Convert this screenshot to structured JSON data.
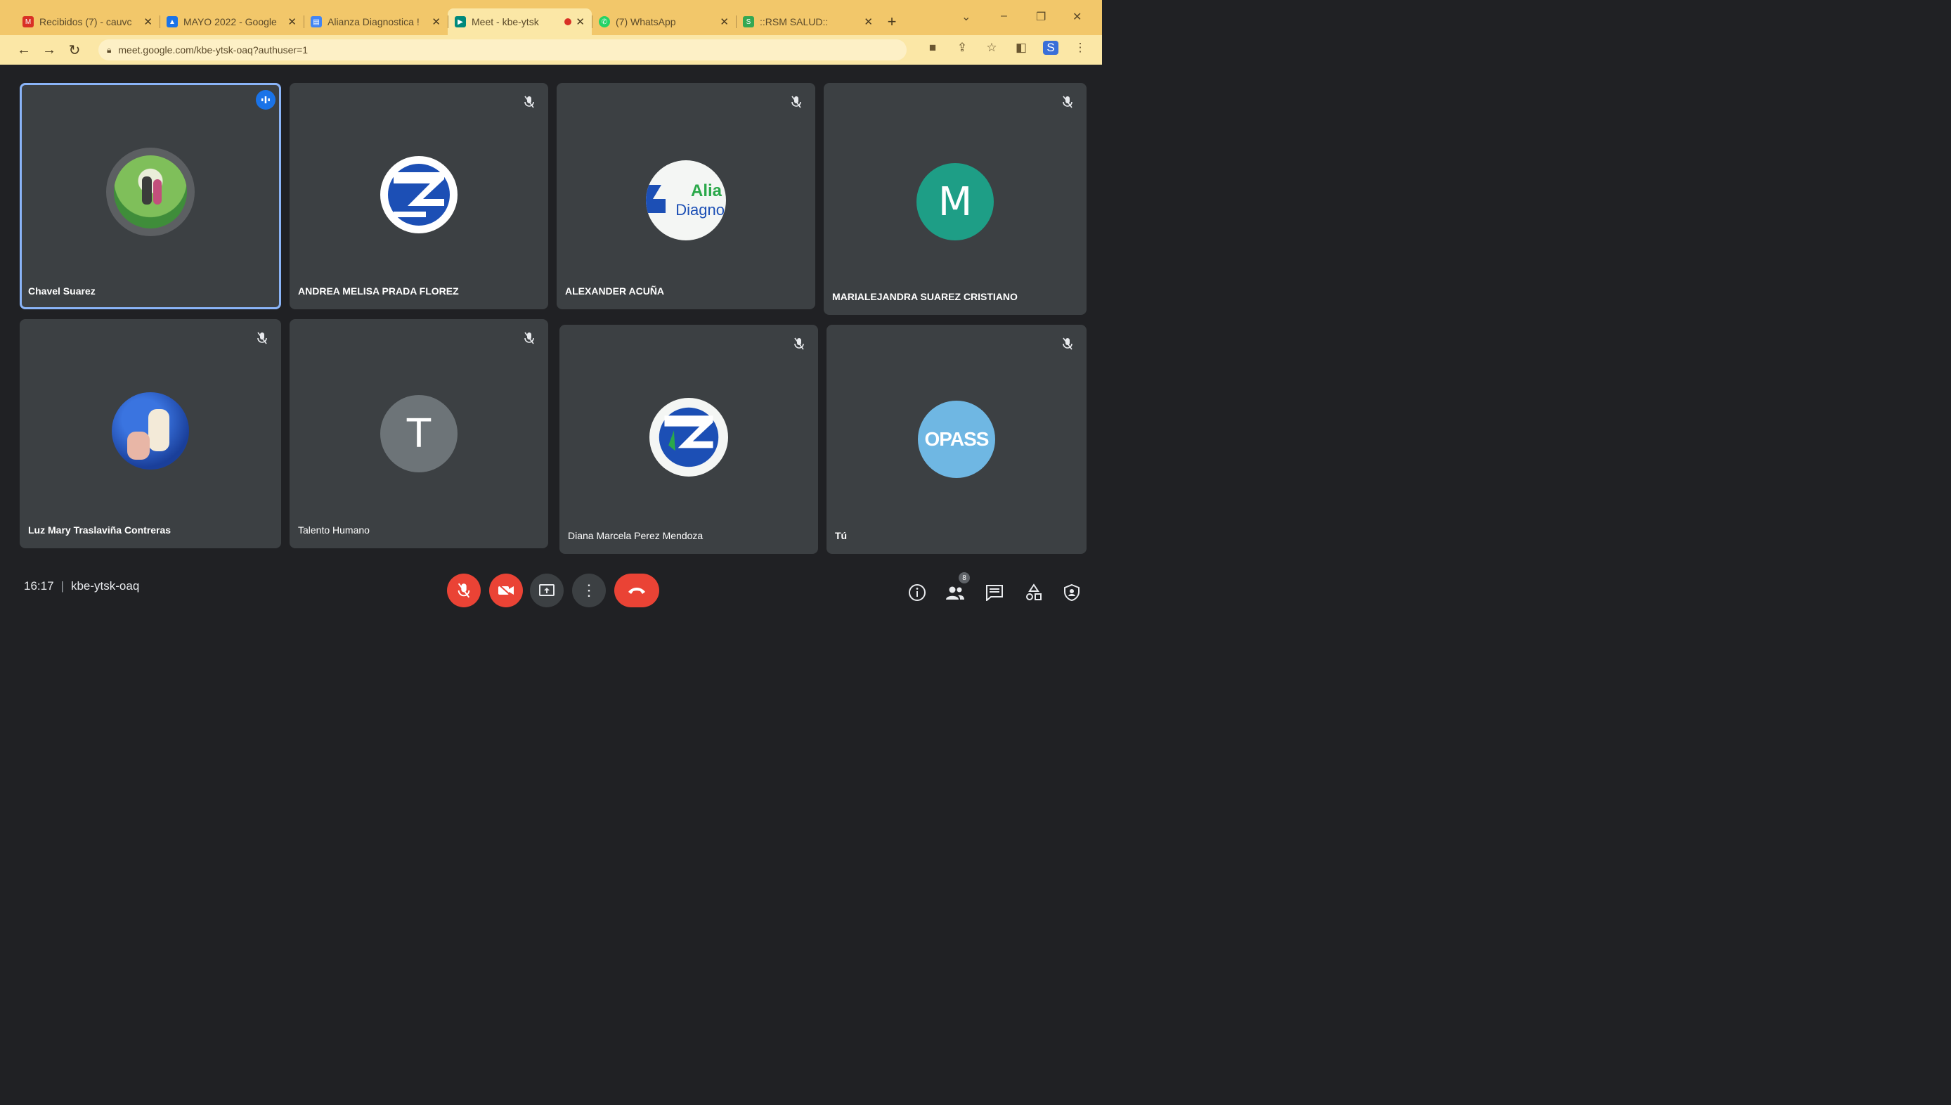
{
  "browser": {
    "tabs": [
      {
        "title": "Recibidos (7) - cauvc",
        "favicon_color": "#d93025",
        "active": false
      },
      {
        "title": "MAYO 2022 - Google",
        "favicon_color": "#1a73e8",
        "active": false
      },
      {
        "title": "Alianza Diagnostica !",
        "favicon_color": "#4285f4",
        "active": false
      },
      {
        "title": "Meet - kbe-ytsk",
        "favicon_color": "#00897b",
        "active": true
      },
      {
        "title": "(7) WhatsApp",
        "favicon_color": "#25d366",
        "active": false
      },
      {
        "title": "::RSM SALUD::",
        "favicon_color": "#34a853",
        "active": false
      }
    ],
    "new_tab_label": "+",
    "url": "meet.google.com/kbe-ytsk-oaq?authuser=1"
  },
  "participants": [
    {
      "name": "Chavel Suarez",
      "avatar_type": "photo",
      "avatar_color": "#4caf50",
      "speaking": true
    },
    {
      "name": "ANDREA MELISA PRADA FLOREZ",
      "avatar_type": "logo",
      "avatar_color": "#ffffff",
      "speaking": false
    },
    {
      "name": "ALEXANDER ACUÑA",
      "avatar_type": "logo",
      "avatar_color": "#ffffff",
      "speaking": false
    },
    {
      "name": "MARIALEJANDRA SUAREZ CRISTIANO",
      "avatar_type": "letter",
      "letter": "M",
      "avatar_color": "#1e9e86",
      "speaking": false
    },
    {
      "name": "Luz Mary Traslaviña Contreras",
      "avatar_type": "photo",
      "avatar_color": "#1a4fb0",
      "speaking": false
    },
    {
      "name": "Talento Humano",
      "avatar_type": "letter",
      "letter": "T",
      "avatar_color": "#6d7478",
      "speaking": false
    },
    {
      "name": "Diana Marcela Perez Mendoza",
      "avatar_type": "logo",
      "avatar_color": "#ffffff",
      "speaking": false
    },
    {
      "name": "Tú",
      "avatar_type": "logo",
      "avatar_color": "#6fb7e3",
      "speaking": false
    }
  ],
  "logo_text": {
    "alianza_line1": "Alia",
    "alianza_line2": "Diagno",
    "opass": "OPASS"
  },
  "meeting": {
    "time": "16:17",
    "code": "kbe-ytsk-oaq",
    "participants_badge": "8"
  },
  "icons": {
    "back": "arrow-left-icon",
    "forward": "arrow-right-icon",
    "reload": "reload-icon",
    "mic": "mic-off-icon",
    "camera": "camera-off-icon",
    "present": "present-screen-icon",
    "more": "more-vert-icon",
    "hangup": "call-end-icon",
    "info": "info-icon",
    "people": "people-icon",
    "chat": "chat-icon",
    "activities": "activities-icon",
    "host": "host-controls-icon"
  },
  "colors": {
    "tab_strip": "#f2c76a",
    "toolbar": "#fbe7a6",
    "meet_bg": "#202124",
    "tile_bg": "#3c4043",
    "accent_red": "#ea4335",
    "speaking_outline": "#8ab4f8"
  }
}
